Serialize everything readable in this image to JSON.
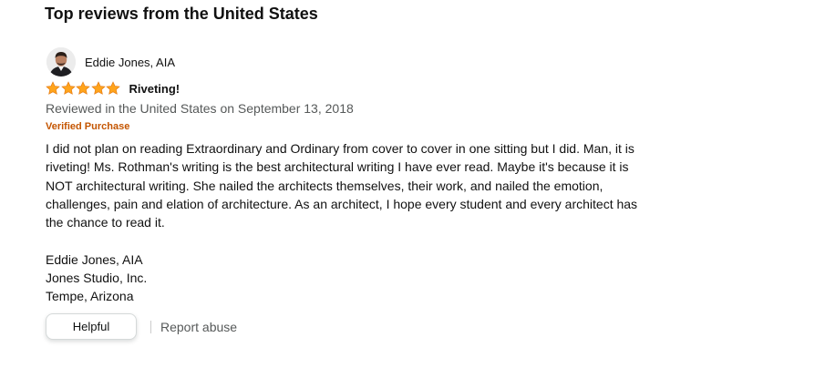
{
  "section": {
    "heading": "Top reviews from the United States"
  },
  "review": {
    "reviewer_name": "Eddie Jones, AIA",
    "rating": 5,
    "rating_max": 5,
    "star_color": "#FFA41C",
    "title": "Riveting!",
    "date_line": "Reviewed in the United States on September 13, 2018",
    "verified_label": "Verified Purchase",
    "verified_color": "#C45500",
    "body_lines": [
      "I did not plan on reading Extraordinary and Ordinary from cover to cover in one sitting but I did. Man, it is",
      "riveting! Ms. Rothman's writing is the best architectural writing I have ever read. Maybe it's because it is",
      "NOT architectural writing. She nailed the architects themselves, their work, and nailed the emotion,",
      "challenges, pain and elation of architecture. As an architect, I hope every student and every architect has",
      "the chance to read it."
    ],
    "signature_lines": [
      "Eddie Jones, AIA",
      "Jones Studio, Inc.",
      "Tempe, Arizona"
    ]
  },
  "actions": {
    "helpful_label": "Helpful",
    "report_label": "Report abuse"
  }
}
